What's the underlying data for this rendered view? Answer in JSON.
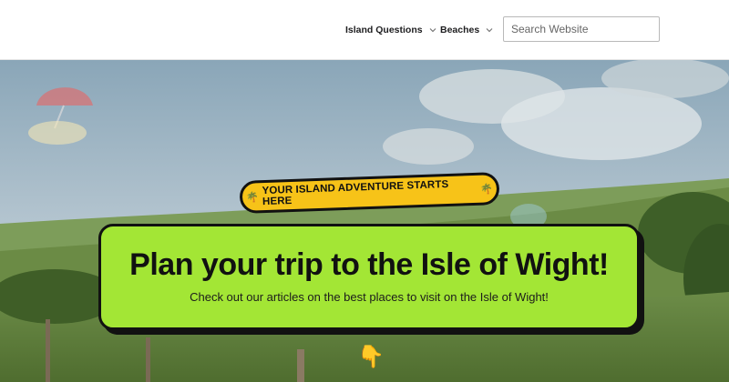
{
  "header": {
    "nav": [
      {
        "label": "Island Questions"
      },
      {
        "label": "Beaches"
      }
    ],
    "search": {
      "placeholder": "Search Website"
    }
  },
  "hero": {
    "tagline": "YOUR ISLAND ADVENTURE STARTS HERE",
    "tagline_icon": "🌴",
    "title": "Plan your trip to the Isle of Wight!",
    "subtitle": "Check out our articles on the best places to visit on the Isle of Wight!",
    "pointer_icon": "👇"
  },
  "colors": {
    "tagline_bg": "#f7c318",
    "card_bg": "#a3e635",
    "border": "#111111"
  }
}
